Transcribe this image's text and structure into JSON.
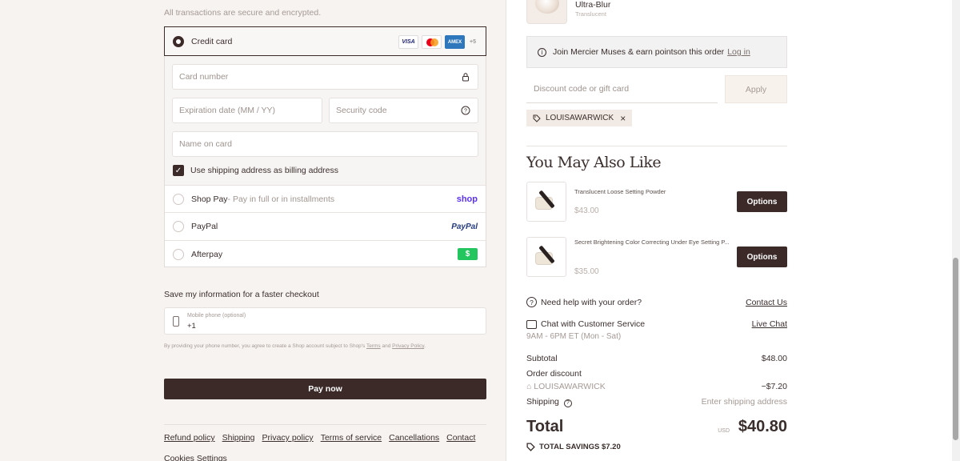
{
  "payment": {
    "subtitle": "All transactions are secure and encrypted.",
    "credit_card_label": "Credit card",
    "card_logos": [
      "VISA",
      "AMEX"
    ],
    "more_logos": "+5",
    "card_number_placeholder": "Card number",
    "expiry_placeholder": "Expiration date (MM / YY)",
    "security_placeholder": "Security code",
    "name_placeholder": "Name on card",
    "use_shipping_label": "Use shipping address as billing address",
    "shop_pay_label": "Shop Pay",
    "shop_pay_sub": " - Pay in full or in installments",
    "shop_logo": "shop",
    "paypal_label": "PayPal",
    "paypal_logo": "PayPal",
    "afterpay_label": "Afterpay",
    "afterpay_logo": "$"
  },
  "save_info": {
    "title": "Save my information for a faster checkout",
    "phone_label": "Mobile phone (optional)",
    "phone_value": "+1",
    "legal_prefix": "By providing your phone number, you agree to create a Shop account subject to Shop's ",
    "terms": "Terms",
    "and": " and ",
    "privacy": "Privacy Policy",
    "legal_suffix": "."
  },
  "pay_now_label": "Pay now",
  "footer_links": [
    "Refund policy",
    "Shipping",
    "Privacy policy",
    "Terms of service",
    "Cancellations",
    "Contact"
  ],
  "cookie_settings": "Cookies Settings",
  "order": {
    "product_name": "Ultra-Blur",
    "product_sub": "Translucent",
    "join_text": "Join Mercier Muses & earn pointson this order",
    "login": "Log in",
    "discount_placeholder": "Discount code or gift card",
    "apply_label": "Apply",
    "applied_code": "LOUISAWARWICK"
  },
  "recommendations": {
    "title": "You May Also Like",
    "items": [
      {
        "name": "Translucent Loose Setting Powder",
        "price": "$43.00",
        "button": "Options"
      },
      {
        "name": "Secret Brightening Color Correcting Under Eye Setting P...",
        "price": "$35.00",
        "button": "Options"
      }
    ]
  },
  "help": {
    "need_help": "Need help with your order?",
    "contact_us": "Contact Us",
    "chat": "Chat with Customer Service",
    "live_chat": "Live Chat",
    "hours": "9AM - 6PM ET (Mon - Sat)"
  },
  "summary": {
    "subtotal_label": "Subtotal",
    "subtotal_value": "$48.00",
    "discount_label": "Order discount",
    "discount_code": "LOUISAWARWICK",
    "discount_value": "−$7.20",
    "shipping_label": "Shipping",
    "shipping_value": "Enter shipping address",
    "total_label": "Total",
    "currency": "USD",
    "total_value": "$40.80",
    "savings_label": "TOTAL SAVINGS",
    "savings_value": "$7.20"
  }
}
